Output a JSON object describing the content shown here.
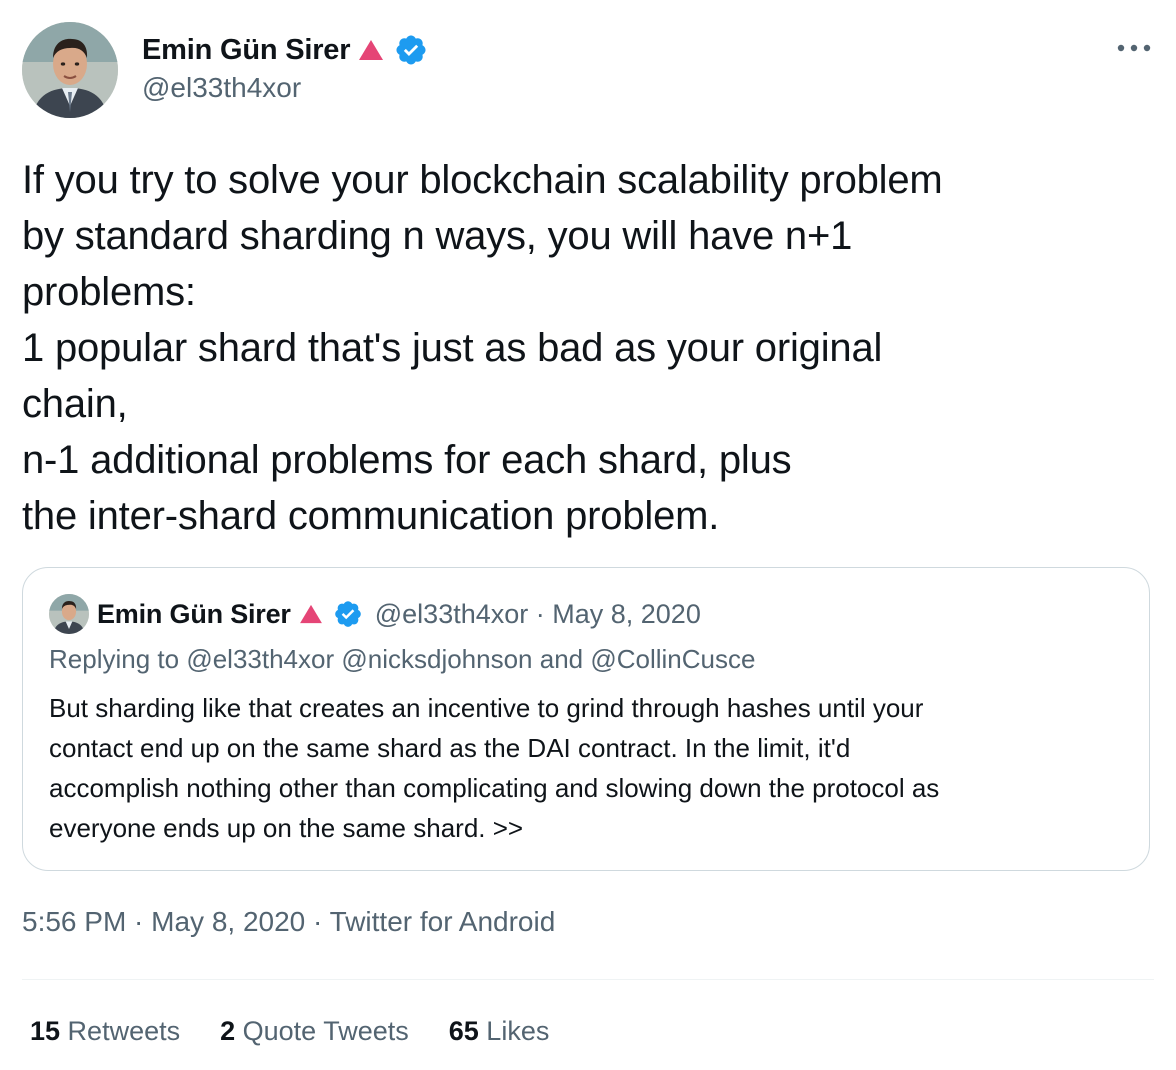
{
  "author": {
    "display_name": "Emin Gün Sirer",
    "handle": "@el33th4xor",
    "badge_icon": "red-triangle-icon",
    "verified_icon": "verified-badge-icon"
  },
  "more_icon": "more-options-icon",
  "tweet": {
    "lines": [
      "If you try to solve your blockchain scalability problem",
      "by standard sharding n ways, you will have n+1",
      "problems:",
      "1 popular shard that's just as bad as your original",
      "chain,",
      "n-1 additional problems for each shard, plus",
      "the inter-shard communication problem."
    ]
  },
  "quote": {
    "display_name": "Emin Gün Sirer",
    "meta": "@el33th4xor · May 8, 2020",
    "replying_prefix": "Replying to ",
    "replying_mentions": "@el33th4xor @nicksdjohnson and @CollinCusce",
    "lines": [
      "But sharding like that creates an incentive to grind through hashes until your",
      "contact end up on the same shard as the DAI contract. In the limit, it'd",
      "accomplish nothing other than complicating and slowing down the protocol as",
      "everyone ends up on the same shard. >>"
    ]
  },
  "meta": {
    "timestamp": "5:56 PM · May 8, 2020 · Twitter for Android"
  },
  "stats": {
    "retweets_count": "15",
    "retweets_label": " Retweets",
    "quotes_count": "2",
    "quotes_label": " Quote Tweets",
    "likes_count": "65",
    "likes_label": " Likes"
  },
  "colors": {
    "primary_text": "#0f1419",
    "secondary_text": "#536471",
    "verified_blue": "#1d9bf0",
    "badge_red": "#e0245e",
    "border": "#cfd9de"
  }
}
